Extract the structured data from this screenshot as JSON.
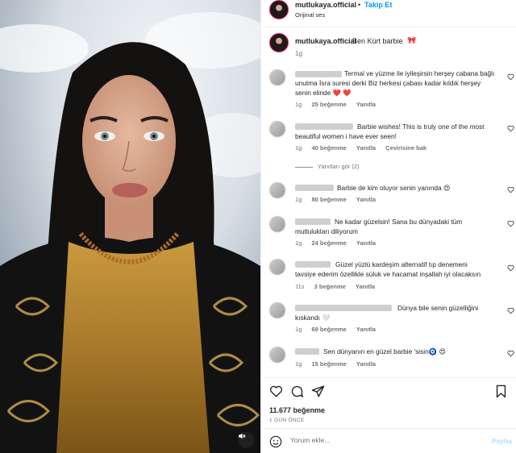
{
  "post": {
    "username": "mutlukaya.official",
    "follow_label": "Takip Et",
    "separator": "•",
    "audio": "Orijinal ses",
    "caption": {
      "username": "mutlukaya.official",
      "text": "Ben Kürt barbie",
      "emoji": "🎀",
      "time": "1g"
    }
  },
  "comments": [
    {
      "lines": [
        "Termal ve yüzme ile iyileşirsin herşey cabana bağlı",
        "unutma İsra suresi derki Biz herkesi çabası kadar kıldık herşey",
        "senin elinde ❤️ ❤️"
      ],
      "time": "1g",
      "likes": "25 beğenme",
      "reply": "Yanıtla",
      "extra": ""
    },
    {
      "lines": [
        "Barbie wishes! This is truly one of the most",
        "beautiful women i have ever seen!"
      ],
      "time": "1g",
      "likes": "40 beğenme",
      "reply": "Yanıtla",
      "extra": "Çevirisine bak"
    },
    {
      "lines": [
        "Barbie de kim oluyor senin yanında 😍"
      ],
      "time": "1g",
      "likes": "80 beğenme",
      "reply": "Yanıtla",
      "extra": ""
    },
    {
      "lines": [
        "Ne kadar güzelsin! Sana bu dünyadaki tüm",
        "mutlulukları diliyorum"
      ],
      "time": "1g",
      "likes": "24 beğenme",
      "reply": "Yanıtla",
      "extra": ""
    },
    {
      "lines": [
        "Güzel yüzlü kardeşim alternatif tıp denemeni",
        "tavsiye ederim özellikle süluk ve hacamat inşallah iyi olacaksın"
      ],
      "time": "11s",
      "likes": "3 beğenme",
      "reply": "Yanıtla",
      "extra": ""
    },
    {
      "lines": [
        "Dünya bile senin güzelliğini",
        "kıskandı 🤍"
      ],
      "time": "1g",
      "likes": "69 beğenme",
      "reply": "Yanıtla",
      "extra": ""
    },
    {
      "lines": [
        "Sen dünyanın en güzel barbie 'sisin🧿 😍"
      ],
      "time": "1g",
      "likes": "15 beğenme",
      "reply": "Yanıtla",
      "extra": ""
    }
  ],
  "view_replies": "Yanıtları gör (2)",
  "footer": {
    "likes": "11.677 beğenme",
    "ago": "1 GÜN ÖNCE",
    "comment_placeholder": "Yorum ekle...",
    "post_label": "Paylaş"
  },
  "colors": {
    "accent": "#0095f6",
    "text": "#262626",
    "muted": "#737373",
    "border": "#efefef"
  },
  "icons": [
    "heart-icon",
    "comment-icon",
    "share-icon",
    "bookmark-icon",
    "emoji-icon",
    "sound-off-icon"
  ]
}
